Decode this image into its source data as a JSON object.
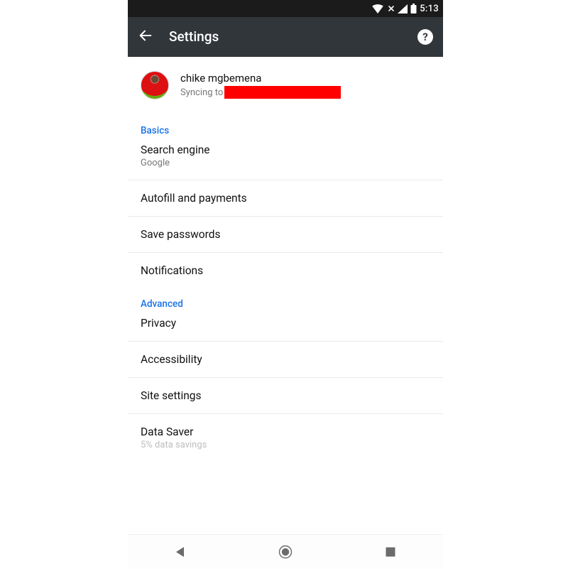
{
  "status": {
    "time": "5:13",
    "icons": {
      "wifi": "wifi-icon",
      "cell_nodata": "cell-nodata-icon",
      "cell_signal": "cell-signal-icon",
      "battery": "battery-icon"
    }
  },
  "appbar": {
    "title": "Settings",
    "back": "back-icon",
    "help": "?"
  },
  "account": {
    "name": "chike mgbemena",
    "sync_prefix": "Syncing to"
  },
  "sections": [
    {
      "header": "Basics",
      "items": [
        {
          "primary": "Search engine",
          "secondary": "Google"
        },
        {
          "primary": "Autofill and payments"
        },
        {
          "primary": "Save passwords"
        },
        {
          "primary": "Notifications"
        }
      ]
    },
    {
      "header": "Advanced",
      "items": [
        {
          "primary": "Privacy"
        },
        {
          "primary": "Accessibility"
        },
        {
          "primary": "Site settings"
        },
        {
          "primary": "Data Saver",
          "secondary": "5% data savings"
        }
      ]
    }
  ],
  "nav": {
    "back": "nav-back-icon",
    "home": "nav-home-icon",
    "recent": "nav-recent-icon"
  },
  "colors": {
    "accent": "#1a73e8",
    "appbar_bg": "#31363a",
    "status_bg": "#1b1b1b",
    "redaction": "#ff0000"
  }
}
